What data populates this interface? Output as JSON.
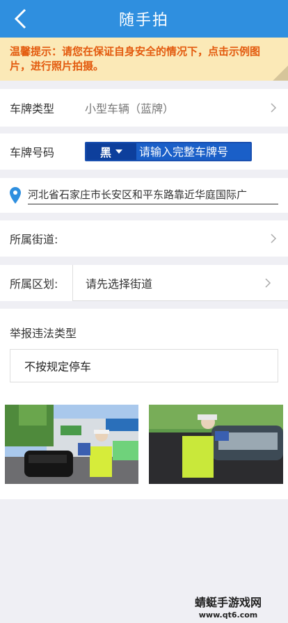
{
  "header": {
    "title": "随手拍"
  },
  "notice": {
    "text": "温馨提示：请您在保证自身安全的情况下，点击示例图片，进行照片拍摄。"
  },
  "plate_type": {
    "label": "车牌类型",
    "value": "小型车辆（蓝牌）"
  },
  "plate_number": {
    "label": "车牌号码",
    "prefix": "黑",
    "placeholder": "请输入完整车牌号"
  },
  "location": {
    "address": "河北省石家庄市长安区和平东路靠近华庭国际广"
  },
  "street": {
    "label": "所属街道:"
  },
  "district": {
    "label": "所属区划:",
    "value": "请先选择街道"
  },
  "violation": {
    "label": "举报违法类型",
    "value": "不按规定停车"
  },
  "watermark": {
    "title": "蜻蜓手游戏网",
    "url": "www.qt6.com"
  },
  "colors": {
    "header": "#2f8fdf",
    "notice_bg": "#fbe9b7",
    "notice_text": "#e35a0e",
    "plate_blue": "#1a5fc8"
  }
}
